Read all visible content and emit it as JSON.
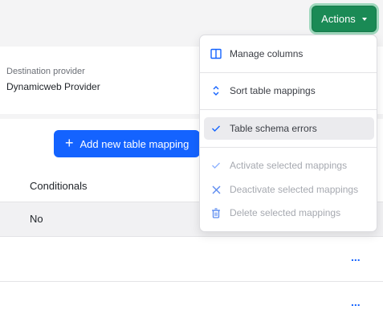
{
  "header": {
    "actions_label": "Actions"
  },
  "destination": {
    "label": "Destination provider",
    "value": "Dynamicweb Provider"
  },
  "table": {
    "add_button_label": "Add new table mapping",
    "columns": {
      "conditionals": "Conditionals"
    },
    "rows": [
      {
        "conditionals": "No"
      }
    ],
    "row_menu_glyph": "..."
  },
  "menu": {
    "items": [
      {
        "label": "Manage columns",
        "icon": "columns-icon",
        "state": "enabled"
      },
      {
        "label": "Sort table mappings",
        "icon": "sort-icon",
        "state": "enabled"
      },
      {
        "label": "Table schema errors",
        "icon": "check-icon",
        "state": "active"
      },
      {
        "label": "Activate selected mappings",
        "icon": "check-icon",
        "state": "disabled"
      },
      {
        "label": "Deactivate selected mappings",
        "icon": "x-icon",
        "state": "disabled"
      },
      {
        "label": "Delete selected mappings",
        "icon": "trash-icon",
        "state": "disabled"
      }
    ]
  },
  "colors": {
    "primary": "#1463ff",
    "actions_green": "#1a8a55",
    "disabled_text": "#a6a9b0"
  }
}
